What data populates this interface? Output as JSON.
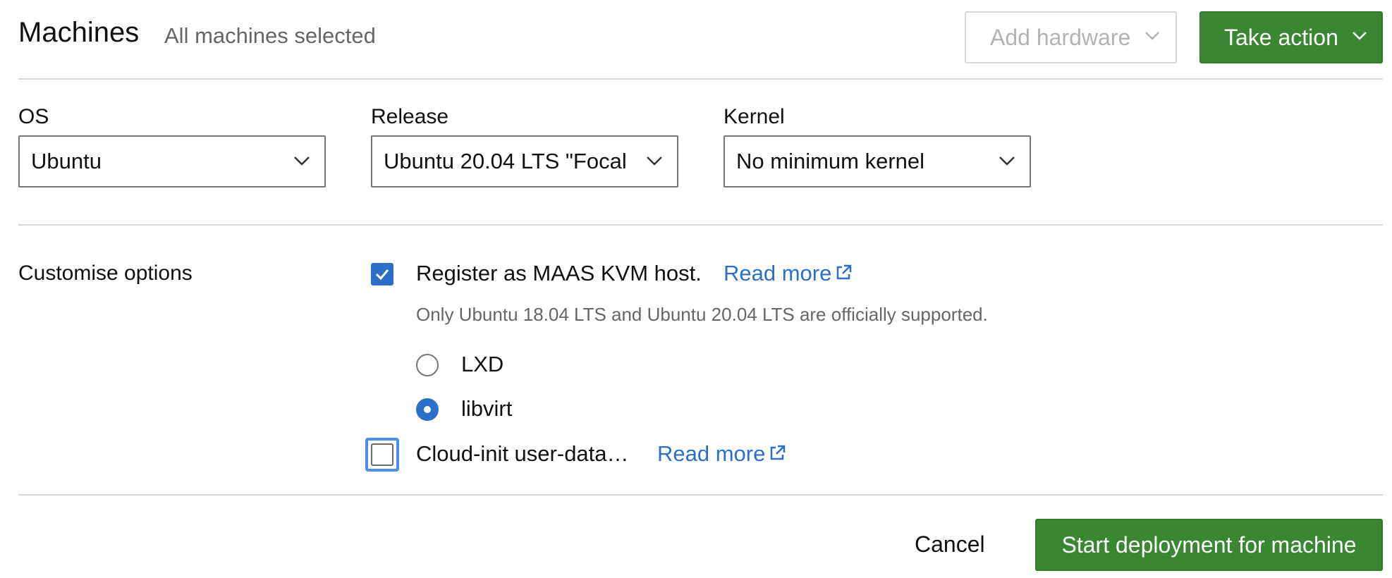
{
  "header": {
    "title": "Machines",
    "subtitle": "All machines selected",
    "add_hardware_label": "Add hardware",
    "take_action_label": "Take action"
  },
  "deploy_form": {
    "os": {
      "label": "OS",
      "value": "Ubuntu"
    },
    "release": {
      "label": "Release",
      "value": "Ubuntu 20.04 LTS \"Focal"
    },
    "kernel": {
      "label": "Kernel",
      "value": "No minimum kernel"
    }
  },
  "options": {
    "section_label": "Customise options",
    "register_kvm": {
      "label": "Register as MAAS KVM host.",
      "checked": true,
      "read_more": "Read more",
      "help_text": "Only Ubuntu 18.04 LTS and Ubuntu 20.04 LTS are officially supported."
    },
    "kvm_types": [
      {
        "label": "LXD",
        "selected": false
      },
      {
        "label": "libvirt",
        "selected": true
      }
    ],
    "cloud_init": {
      "label": "Cloud-init user-data…",
      "checked": false,
      "read_more": "Read more"
    }
  },
  "footer": {
    "cancel_label": "Cancel",
    "submit_label": "Start deployment for machine"
  },
  "colors": {
    "primary_green": "#3a8633",
    "link_blue": "#2c6fc8",
    "focus_blue": "#4c8fe6",
    "divider": "#d9d9d9"
  }
}
